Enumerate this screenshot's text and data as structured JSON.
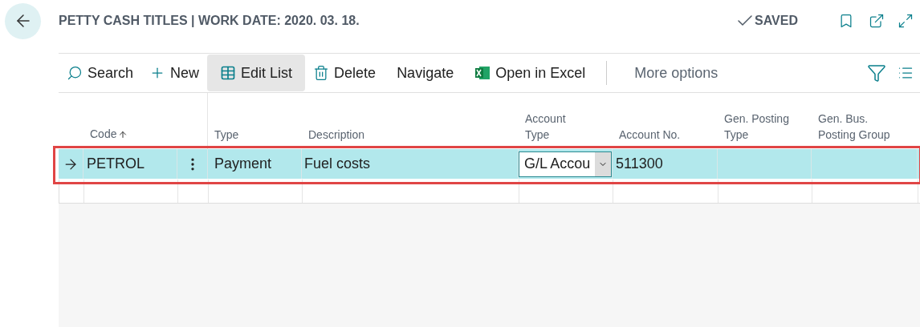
{
  "header": {
    "title": "PETTY CASH TITLES | WORK DATE: 2020. 03. 18.",
    "status": "SAVED"
  },
  "actions": [
    {
      "kind": "search",
      "label": "Search",
      "selected": false
    },
    {
      "kind": "new",
      "label": "New",
      "selected": false
    },
    {
      "kind": "edit",
      "label": "Edit List",
      "selected": true
    },
    {
      "kind": "delete",
      "label": "Delete",
      "selected": false
    },
    {
      "kind": "plain",
      "label": "Navigate",
      "selected": false
    },
    {
      "kind": "excel",
      "label": "Open in Excel",
      "selected": false
    },
    {
      "kind": "more",
      "label": "More options",
      "selected": false
    }
  ],
  "table": {
    "columns": [
      {
        "label": "Code",
        "sorted": true
      },
      {
        "label": "Type",
        "sorted": false
      },
      {
        "label": "Description",
        "sorted": false
      },
      {
        "label": "Account Type",
        "sorted": false
      },
      {
        "label": "Account No.",
        "sorted": false
      },
      {
        "label": "Gen. Posting Type",
        "sorted": false
      },
      {
        "label": "Gen. Bus. Posting Group",
        "sorted": false
      }
    ],
    "rows": [
      {
        "selected": true,
        "outlined": true,
        "code": "PETROL",
        "type": "Payment",
        "description": "Fuel costs",
        "account_type": "G/L Accou",
        "account_no": "511300"
      }
    ]
  }
}
